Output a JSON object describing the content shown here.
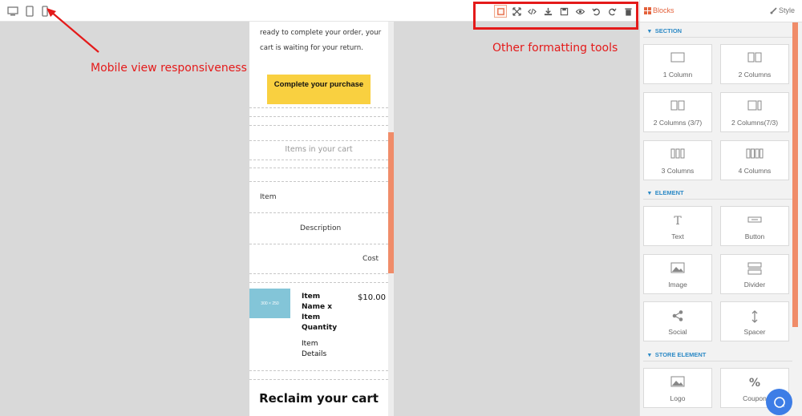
{
  "toolbar": {
    "device_buttons": [
      {
        "name": "desktop-icon"
      },
      {
        "name": "tablet-icon"
      },
      {
        "name": "mobile-icon"
      }
    ],
    "tools": [
      {
        "name": "border-toggle-icon",
        "active": true
      },
      {
        "name": "fullscreen-icon"
      },
      {
        "name": "code-icon"
      },
      {
        "name": "download-icon"
      },
      {
        "name": "save-icon"
      },
      {
        "name": "preview-eye-icon"
      },
      {
        "name": "undo-icon"
      },
      {
        "name": "redo-icon"
      },
      {
        "name": "trash-icon"
      }
    ]
  },
  "annotations": {
    "mobile": "Mobile view responsiveness",
    "tools": "Other formatting tools"
  },
  "email": {
    "intro_line1": "ready to complete your order, your",
    "intro_line2": "cart is waiting for your return.",
    "cta_label": "Complete your purchase",
    "items_heading": "Items in your cart",
    "col_item": "Item",
    "col_description": "Description",
    "col_cost": "Cost",
    "product_image_label": "300 × 250",
    "product_name_lines": [
      "Item",
      "Name x",
      "Item",
      "Quantity"
    ],
    "product_price": "$10.00",
    "product_details_lines": [
      "Item",
      "Details"
    ],
    "reclaim_heading": "Reclaim your cart"
  },
  "panel": {
    "blocks_tab": "Blocks",
    "style_tab": "Style",
    "sections": [
      {
        "title": "SECTION",
        "items": [
          {
            "label": "1 Column",
            "icon": "one-column-icon"
          },
          {
            "label": "2 Columns",
            "icon": "two-columns-icon"
          },
          {
            "label": "2 Columns (3/7)",
            "icon": "two-columns-37-icon"
          },
          {
            "label": "2 Columns(7/3)",
            "icon": "two-columns-73-icon"
          },
          {
            "label": "3 Columns",
            "icon": "three-columns-icon"
          },
          {
            "label": "4 Columns",
            "icon": "four-columns-icon"
          }
        ]
      },
      {
        "title": "ELEMENT",
        "items": [
          {
            "label": "Text",
            "icon": "text-icon"
          },
          {
            "label": "Button",
            "icon": "button-icon"
          },
          {
            "label": "Image",
            "icon": "image-icon"
          },
          {
            "label": "Divider",
            "icon": "divider-icon"
          },
          {
            "label": "Social",
            "icon": "share-icon"
          },
          {
            "label": "Spacer",
            "icon": "spacer-icon"
          }
        ]
      },
      {
        "title": "STORE ELEMENT",
        "items": [
          {
            "label": "Logo",
            "icon": "logo-image-icon"
          },
          {
            "label": "Coupon",
            "icon": "percent-icon"
          }
        ]
      }
    ]
  },
  "colors": {
    "accent": "#e4623c",
    "annotation": "#e41a1a",
    "cta": "#f9d040",
    "section_title": "#2d8ac6",
    "chat": "#3d7de6"
  }
}
